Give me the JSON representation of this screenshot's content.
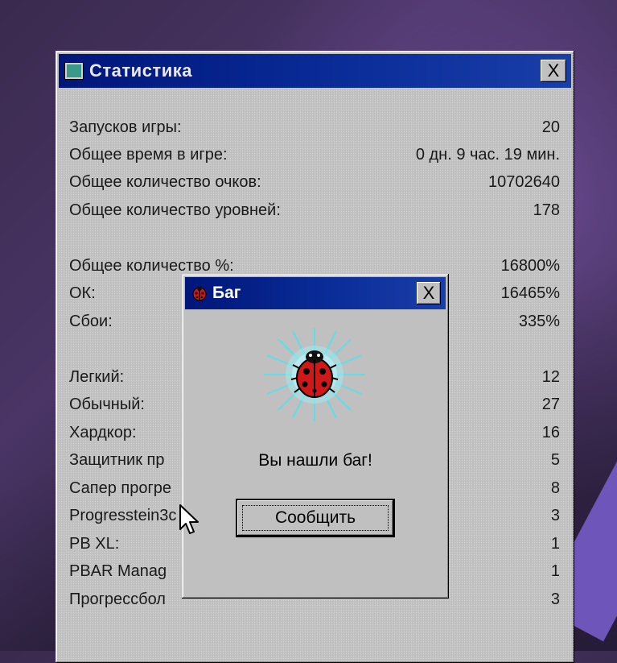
{
  "stats_window": {
    "title": "Статистика",
    "close": "X",
    "rows": [
      {
        "label": "Запусков игры:",
        "value": "20"
      },
      {
        "label": "Общее время в игре:",
        "value": "0 дн. 9 час. 19 мин."
      },
      {
        "label": "Общее количество очков:",
        "value": "10702640"
      },
      {
        "label": "Общее количество уровней:",
        "value": "178"
      },
      {
        "label": "Общее количество %:",
        "value": "16800%"
      },
      {
        "label": "ОК:",
        "value": "16465%"
      },
      {
        "label": "Сбои:",
        "value": "335%"
      },
      {
        "label": "Легкий:",
        "value": "12"
      },
      {
        "label": "Обычный:",
        "value": "27"
      },
      {
        "label": "Хардкор:",
        "value": "16"
      },
      {
        "label": "Защитник пр",
        "value": "5"
      },
      {
        "label": "Сапер прогре",
        "value": "8"
      },
      {
        "label": "Progresstein3c",
        "value": "3"
      },
      {
        "label": "PB XL:",
        "value": "1"
      },
      {
        "label": "PBAR Manag",
        "value": "1"
      },
      {
        "label": "Прогрессбол",
        "value": "3"
      }
    ]
  },
  "bug_dialog": {
    "title": "Баг",
    "close": "X",
    "message": "Вы нашли баг!",
    "button": "Сообщить"
  },
  "colors": {
    "titlebar": "#00167a",
    "window": "#c0c0c0",
    "bug_red": "#d01818",
    "glow": "#4fe3f0"
  },
  "icons": {
    "stats_window": "window-icon",
    "dialog": "ladybug-icon",
    "pointer": "mouse-cursor-icon"
  }
}
